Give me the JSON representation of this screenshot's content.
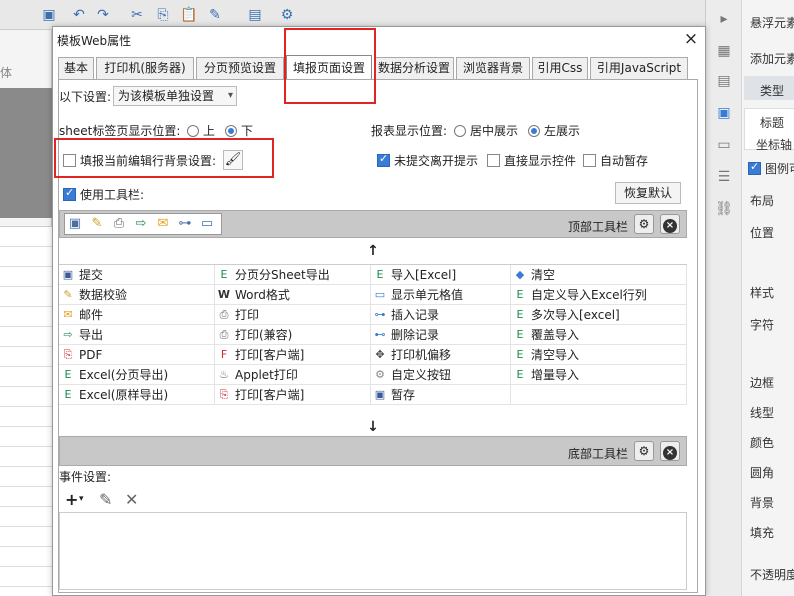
{
  "dialog": {
    "title": "模板Web属性",
    "close": "×"
  },
  "tabs": [
    "基本",
    "打印机(服务器)",
    "分页预览设置",
    "填报页面设置",
    "数据分析设置",
    "浏览器背景",
    "引用Css",
    "引用JavaScript"
  ],
  "setting": {
    "label": "以下设置:",
    "value": "为该模板单独设置"
  },
  "sheet": {
    "label": "sheet标签页显示位置:",
    "opt_up": "上",
    "opt_down": "下",
    "selected": "下"
  },
  "report": {
    "label": "报表显示位置:",
    "opt_center": "居中展示",
    "opt_left": "左展示",
    "selected": "左展示"
  },
  "fill_bg": {
    "label": "填报当前编辑行背景设置:",
    "checked": false
  },
  "options": {
    "unsubmitted": "未提交离开提示",
    "unsubmitted_checked": true,
    "show_control": "直接显示控件",
    "show_control_checked": false,
    "autosave": "自动暂存",
    "autosave_checked": false
  },
  "toolbar": {
    "use_label": "使用工具栏:",
    "use_checked": true,
    "restore": "恢复默认",
    "top_label": "顶部工具栏",
    "bottom_label": "底部工具栏",
    "up_arrow": "↑",
    "down_arrow": "↓",
    "header_icons": [
      "save-icon",
      "verify-icon",
      "print-icon",
      "export-icon",
      "email-icon",
      "insert-record-icon",
      "display-cell-icon"
    ]
  },
  "buttons": [
    [
      "提交",
      "分页分Sheet导出",
      "导入[Excel]",
      "清空"
    ],
    [
      "数据校验",
      "Word格式",
      "显示单元格值",
      "自定义导入Excel行列"
    ],
    [
      "邮件",
      "打印",
      "插入记录",
      "多次导入[excel]"
    ],
    [
      "导出",
      "打印(兼容)",
      "删除记录",
      "覆盖导入"
    ],
    [
      "PDF",
      "打印[客户端]",
      "打印机偏移",
      "清空导入"
    ],
    [
      "Excel(分页导出)",
      "Applet打印",
      "自定义按钮",
      "增量导入"
    ],
    [
      "Excel(原样导出)",
      "打印[客户端]",
      "暂存",
      ""
    ]
  ],
  "events": {
    "label": "事件设置:",
    "add": "+",
    "edit": "✎",
    "delete": "✕"
  },
  "right_panel": {
    "items": [
      "悬浮元素",
      "添加元素",
      "类型",
      "标题",
      "坐标轴",
      "图例可",
      "布局",
      "位置",
      "样式",
      "字符",
      "边框",
      "线型",
      "颜色",
      "圆角",
      "背景",
      "填充",
      "不透明度"
    ]
  },
  "left_panel": {
    "label": "体"
  },
  "colors": {
    "accent": "#3a7bd5",
    "highlight": "#e02424"
  }
}
